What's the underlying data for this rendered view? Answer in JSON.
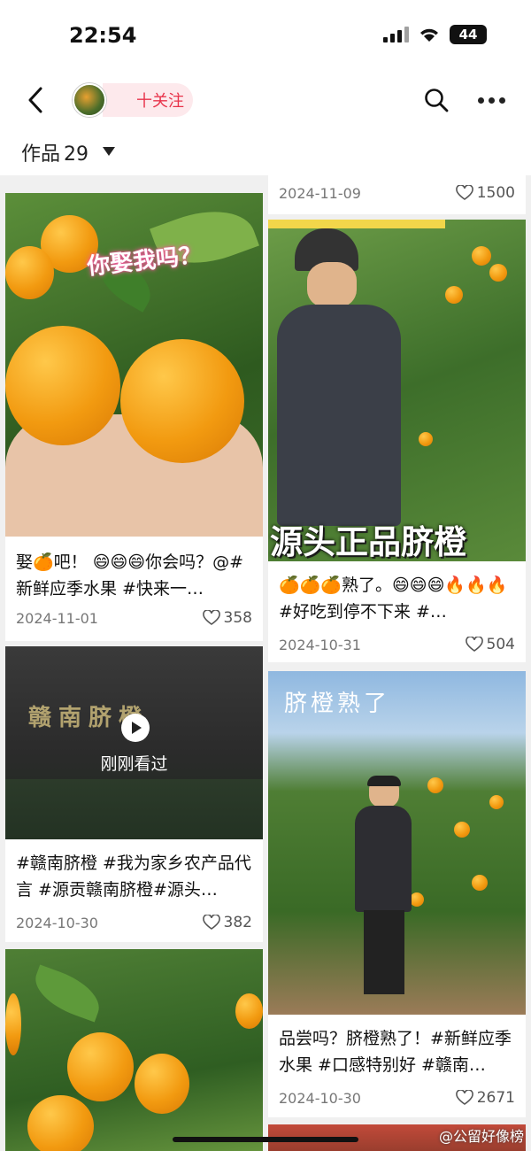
{
  "status_bar": {
    "time": "22:54",
    "battery": "44"
  },
  "header": {
    "follow_label": "十关注"
  },
  "works": {
    "label": "作品",
    "count": "29"
  },
  "posts": [
    {
      "overlay_text": "你娶我吗？",
      "caption": "娶🍊吧！ 😄😄😄你会吗？@#新鲜应季水果 #快来一…",
      "date": "2024-11-01",
      "likes": "358"
    },
    {
      "overlay_text": "赣南脐橙",
      "caption": "#赣南脐橙 #我为家乡农产品代言 #源贡赣南脐橙#源头…",
      "date": "2024-10-30",
      "likes": "382",
      "watched_label": "刚刚看过"
    },
    {
      "date": "",
      "likes": ""
    },
    {
      "date": "2024-11-09",
      "likes": "1500"
    },
    {
      "overlay_text": "源头正品脐橙",
      "caption": "🍊🍊🍊熟了。😄😄😄🔥🔥🔥#好吃到停不下来 #…",
      "date": "2024-10-31",
      "likes": "504"
    },
    {
      "overlay_text": "脐橙熟了",
      "caption": "品尝吗？脐橙熟了！#新鲜应季水果 #口感特别好 #赣南…",
      "date": "2024-10-30",
      "likes": "2671"
    }
  ],
  "watermark": "@公留好像榜",
  "icons": {
    "back": "chevron-left-icon",
    "search": "search-icon",
    "more": "more-dots-icon",
    "heart": "heart-icon",
    "play": "play-icon"
  }
}
